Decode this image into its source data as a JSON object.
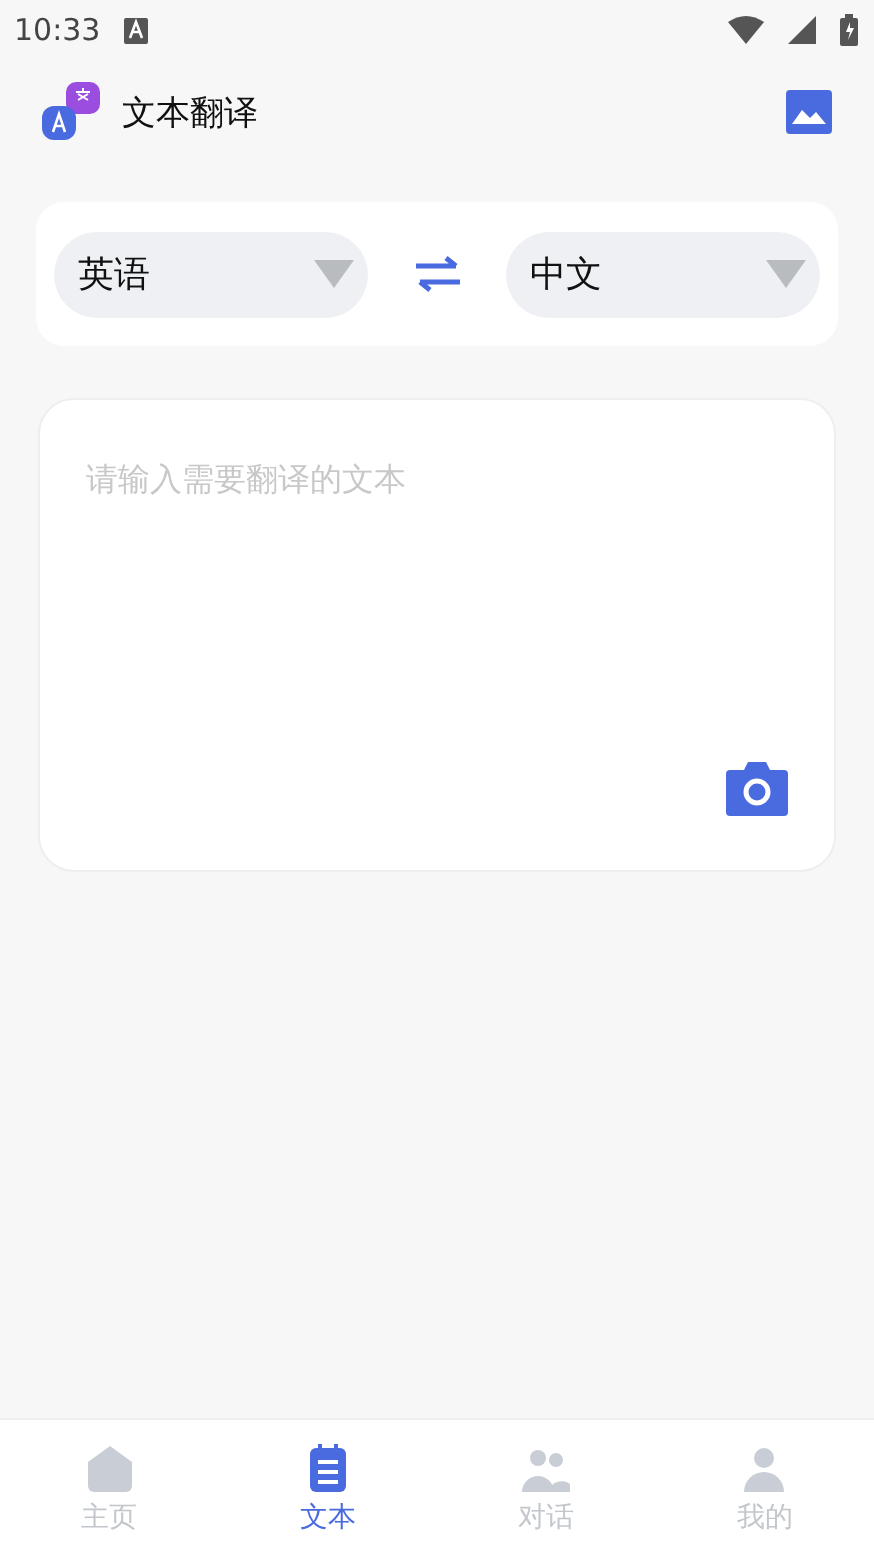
{
  "status_bar": {
    "time": "10:33"
  },
  "header": {
    "title": "文本翻译"
  },
  "languages": {
    "source": "英语",
    "target": "中文"
  },
  "input": {
    "placeholder": "请输入需要翻译的文本"
  },
  "nav": [
    {
      "label": "主页",
      "selected": false
    },
    {
      "label": "文本",
      "selected": true
    },
    {
      "label": "对话",
      "selected": false
    },
    {
      "label": "我的",
      "selected": false
    }
  ]
}
